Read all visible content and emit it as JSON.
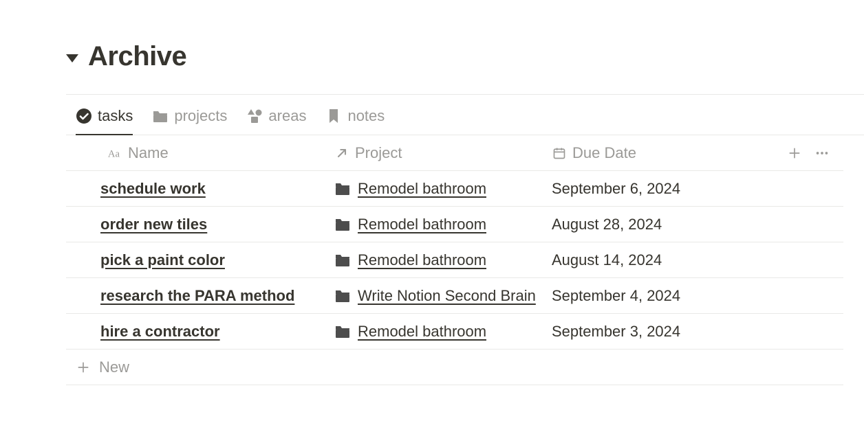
{
  "page": {
    "title": "Archive"
  },
  "tabs": [
    {
      "label": "tasks",
      "icon": "check-circle",
      "active": true
    },
    {
      "label": "projects",
      "icon": "folder",
      "active": false
    },
    {
      "label": "areas",
      "icon": "shapes",
      "active": false
    },
    {
      "label": "notes",
      "icon": "bookmark",
      "active": false
    }
  ],
  "columns": {
    "name": "Name",
    "project": "Project",
    "due_date": "Due Date"
  },
  "rows": [
    {
      "name": "schedule work",
      "project": "Remodel bathroom",
      "due_date": "September 6, 2024"
    },
    {
      "name": "order new tiles",
      "project": "Remodel bathroom",
      "due_date": "August 28, 2024"
    },
    {
      "name": "pick a paint color",
      "project": "Remodel bathroom",
      "due_date": "August 14, 2024"
    },
    {
      "name": "research the PARA method",
      "project": "Write Notion Second Brain",
      "due_date": "September 4, 2024"
    },
    {
      "name": "hire a contractor",
      "project": "Remodel bathroom",
      "due_date": "September 3, 2024"
    }
  ],
  "actions": {
    "new_row": "New"
  }
}
